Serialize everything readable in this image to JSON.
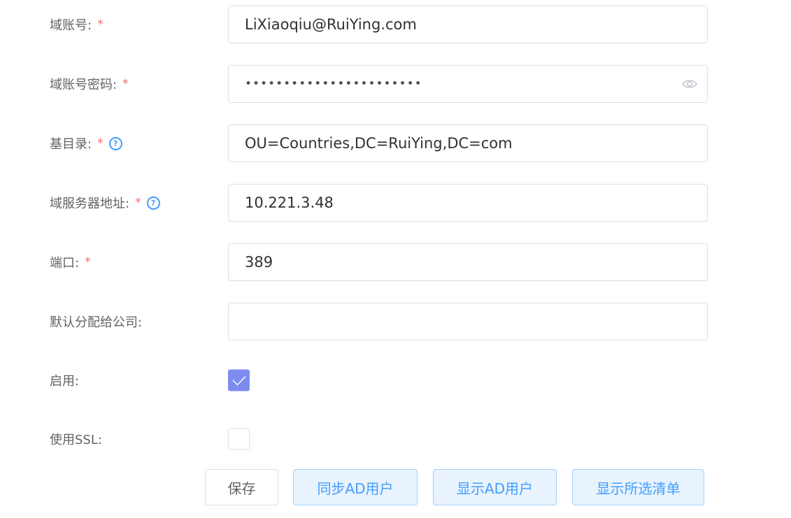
{
  "form": {
    "domain_account": {
      "label": "域账号:",
      "required": "*",
      "value": "LiXiaoqiu@RuiYing.com"
    },
    "domain_password": {
      "label": "域账号密码:",
      "required": "*",
      "value": "•••••••••••••••••••••••"
    },
    "base_dn": {
      "label": "基目录:",
      "required": "*",
      "help": "?",
      "value": "OU=Countries,DC=RuiYing,DC=com"
    },
    "server_address": {
      "label": "域服务器地址:",
      "required": "*",
      "help": "?",
      "value": "10.221.3.48"
    },
    "port": {
      "label": "端口:",
      "required": "*",
      "value": "389"
    },
    "default_company": {
      "label": "默认分配给公司:",
      "value": ""
    },
    "enabled": {
      "label": "启用:",
      "checked": true
    },
    "use_ssl": {
      "label": "使用SSL:",
      "checked": false
    }
  },
  "buttons": {
    "save": "保存",
    "sync_ad_users": "同步AD用户",
    "show_ad_users": "显示AD用户",
    "show_selected_list": "显示所选清单"
  },
  "colors": {
    "required": "#f56c6c",
    "accent": "#409eff",
    "checkbox_checked": "#7e8cf2",
    "border": "#dcdfe6"
  }
}
